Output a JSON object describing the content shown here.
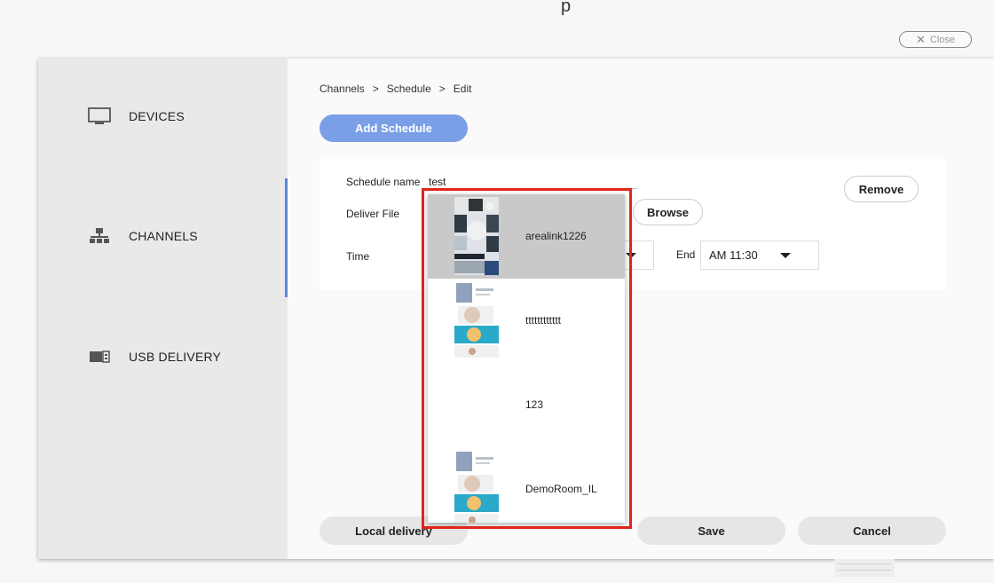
{
  "top_fragment": "p",
  "close_button": {
    "icon": "close-icon",
    "label": "Close"
  },
  "sidebar": {
    "items": [
      {
        "label": "DEVICES",
        "icon": "monitor-icon"
      },
      {
        "label": "CHANNELS",
        "icon": "network-icon",
        "active": true
      },
      {
        "label": "USB DELIVERY",
        "icon": "usb-icon"
      }
    ]
  },
  "breadcrumb": {
    "items": [
      "Channels",
      "Schedule",
      "Edit"
    ],
    "separator": ">"
  },
  "add_schedule_label": "Add Schedule",
  "form": {
    "schedule_name_label": "Schedule name",
    "schedule_name_value": "test",
    "deliver_file_label": "Deliver File",
    "browse_label": "Browse",
    "time_label": "Time",
    "end_label": "End",
    "end_value": "AM 11:30",
    "remove_label": "Remove"
  },
  "dropdown": {
    "items": [
      {
        "label": "arealink1226",
        "selected": true
      },
      {
        "label": "tttttttttttt",
        "selected": false
      },
      {
        "label": "123",
        "selected": false
      },
      {
        "label": "DemoRoom_IL",
        "selected": false
      }
    ]
  },
  "footer": {
    "local_delivery_label": "Local delivery",
    "save_label": "Save",
    "cancel_label": "Cancel"
  },
  "colors": {
    "accent": "#7a9fe6",
    "active_indicator": "#5b86d8",
    "highlight_border": "#e0251a",
    "selected_item_bg": "#c9c9c9"
  }
}
